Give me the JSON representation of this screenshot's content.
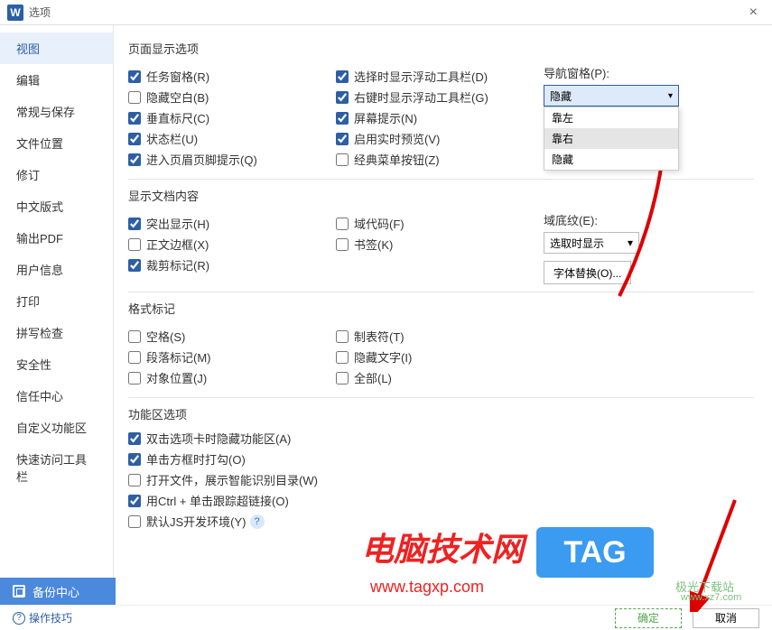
{
  "titlebar": {
    "app_icon": "W",
    "title": "选项"
  },
  "sidebar": {
    "items": [
      "视图",
      "编辑",
      "常规与保存",
      "文件位置",
      "修订",
      "中文版式",
      "输出PDF",
      "用户信息",
      "打印",
      "拼写检查",
      "安全性",
      "信任中心",
      "自定义功能区",
      "快速访问工具栏"
    ]
  },
  "sections": {
    "page_display": {
      "title": "页面显示选项",
      "col1": [
        {
          "label": "任务窗格(R)",
          "checked": true
        },
        {
          "label": "隐藏空白(B)",
          "checked": false
        },
        {
          "label": "垂直标尺(C)",
          "checked": true
        },
        {
          "label": "状态栏(U)",
          "checked": true
        },
        {
          "label": "进入页眉页脚提示(Q)",
          "checked": true
        }
      ],
      "col2": [
        {
          "label": "选择时显示浮动工具栏(D)",
          "checked": true
        },
        {
          "label": "右键时显示浮动工具栏(G)",
          "checked": true
        },
        {
          "label": "屏幕提示(N)",
          "checked": true
        },
        {
          "label": "启用实时预览(V)",
          "checked": true
        },
        {
          "label": "经典菜单按钮(Z)",
          "checked": false
        }
      ],
      "nav_pane": {
        "label": "导航窗格(P):",
        "value": "隐藏",
        "options": [
          "靠左",
          "靠右",
          "隐藏"
        ]
      }
    },
    "doc_content": {
      "title": "显示文档内容",
      "col1": [
        {
          "label": "突出显示(H)",
          "checked": true
        },
        {
          "label": "正文边框(X)",
          "checked": false
        },
        {
          "label": "裁剪标记(R)",
          "checked": true
        }
      ],
      "col2": [
        {
          "label": "域代码(F)",
          "checked": false
        },
        {
          "label": "书签(K)",
          "checked": false
        }
      ],
      "shading": {
        "label": "域底纹(E):",
        "value": "选取时显示"
      },
      "font_btn": "字体替换(O)..."
    },
    "format_marks": {
      "title": "格式标记",
      "col1": [
        {
          "label": "空格(S)",
          "checked": false
        },
        {
          "label": "段落标记(M)",
          "checked": false
        },
        {
          "label": "对象位置(J)",
          "checked": false
        }
      ],
      "col2": [
        {
          "label": "制表符(T)",
          "checked": false
        },
        {
          "label": "隐藏文字(I)",
          "checked": false
        },
        {
          "label": "全部(L)",
          "checked": false
        }
      ]
    },
    "ribbon": {
      "title": "功能区选项",
      "items": [
        {
          "label": "双击选项卡时隐藏功能区(A)",
          "checked": true
        },
        {
          "label": "单击方框时打勾(O)",
          "checked": true
        },
        {
          "label": "打开文件，展示智能识别目录(W)",
          "checked": false
        },
        {
          "label": "用Ctrl + 单击跟踪超链接(O)",
          "checked": true
        },
        {
          "label": "默认JS开发环境(Y)",
          "checked": false,
          "info": true
        }
      ]
    }
  },
  "footer": {
    "backup": "备份中心",
    "tips": "操作技巧",
    "ok": "确定",
    "cancel": "取消"
  },
  "watermarks": {
    "w1": "电脑技术网",
    "w1b": "www.tagxp.com",
    "wtag": "TAG",
    "w2": "极光下载站",
    "w2b": "www.xz7.com"
  }
}
